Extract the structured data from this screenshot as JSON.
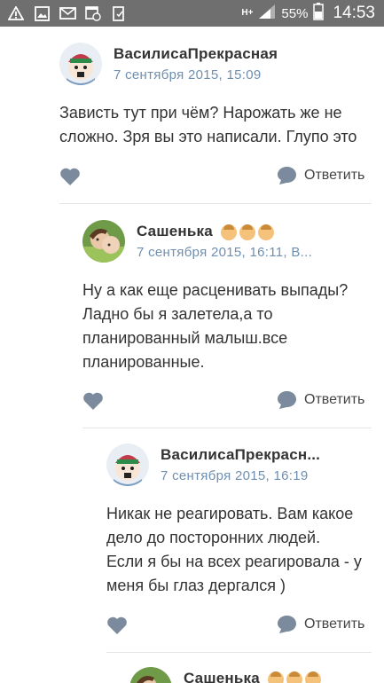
{
  "status_bar": {
    "network": "H+",
    "battery": "55%",
    "time": "14:53",
    "icons": [
      "warning-icon",
      "gallery-icon",
      "mail-icon",
      "calendar-icon",
      "clipboard-icon"
    ]
  },
  "comments": [
    {
      "author": "ВасилисаПрекрасная",
      "date": "7 сентября 2015, 15:09",
      "lines": [
        "Зависть тут при чём? Нарожать же не",
        "сложно. Зря вы это написали. Глупо это"
      ],
      "reply_label": "Ответить"
    },
    {
      "author": "Сашенька",
      "date": "7 сентября 2015, 16:11, В...",
      "lines": [
        "Ну а как еще расценивать выпады?",
        "Ладно бы я залетела,а то",
        "планированный малыш.все",
        "планированные."
      ],
      "reply_label": "Ответить"
    },
    {
      "author": "ВасилисаПрекрасн...",
      "date": "7 сентября 2015, 16:19",
      "lines": [
        "Никак не реагировать. Вам какое",
        "дело до посторонних людей.",
        "Если я бы на всех реагировала - у",
        "меня бы глаз дергался )"
      ],
      "reply_label": "Ответить"
    },
    {
      "author": "Сашенька"
    }
  ],
  "colors": {
    "status_bar": "#6f6f6f",
    "date": "#6f8fb0",
    "icon": "#7b8a9c"
  }
}
